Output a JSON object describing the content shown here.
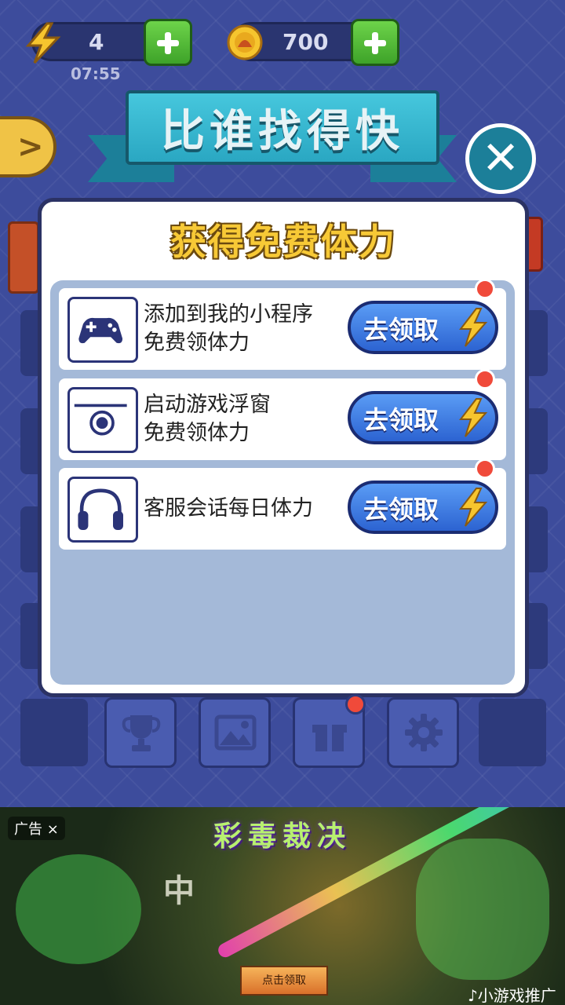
{
  "top_bar": {
    "energy": "4",
    "energy_timer": "07:55",
    "coins": "700"
  },
  "title": "比谁找得快",
  "modal": {
    "title": "获得免费体力",
    "rows": [
      {
        "line1": "添加到我的小程序",
        "line2": "免费领体力",
        "button": "去领取",
        "icon": "gamepad-icon"
      },
      {
        "line1": "启动游戏浮窗",
        "line2": "免费领体力",
        "button": "去领取",
        "icon": "floating-window-icon"
      },
      {
        "line1": "客服会话每日体力",
        "line2": "",
        "button": "去领取",
        "icon": "headset-icon"
      }
    ]
  },
  "bottom_nav": [
    "trophy-icon",
    "image-icon",
    "gift-icon",
    "gear-icon"
  ],
  "ad": {
    "tag": "广告 ×",
    "headline": "彩毒裁决",
    "overlay_char": "中",
    "cta": "点击领取",
    "brand": "♪小游戏推广"
  },
  "colors": {
    "background": "#3d4c9c",
    "accent_blue": "#2c63d1",
    "title_yellow": "#f7c936",
    "banner_teal": "#2aa7c2",
    "notify_red": "#f04a3a"
  }
}
